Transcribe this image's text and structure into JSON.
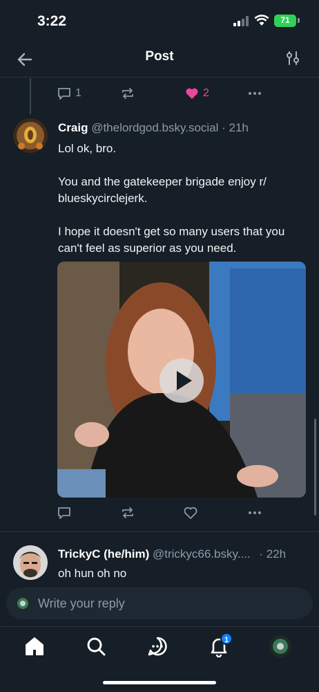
{
  "status": {
    "time": "3:22",
    "battery": "71"
  },
  "header": {
    "title": "Post"
  },
  "prev_post": {
    "reply_count": "1",
    "like_count": "2"
  },
  "post": {
    "author_name": "Craig",
    "author_handle": "@thelordgod.bsky.social",
    "time_ago": "· 21h",
    "paragraphs": [
      "Lol ok, bro.",
      "You and the gatekeeper brigade enjoy r/ blueskycirclejerk.",
      "I hope it doesn't get so many users that you can't feel as superior as you need."
    ]
  },
  "reply_post": {
    "author_name": "TrickyC (he/him)",
    "author_handle": "@trickyc66.bsky....",
    "time_ago": "· 22h",
    "text": "oh hun oh no"
  },
  "composer": {
    "placeholder": "Write your reply"
  },
  "tabs": {
    "notification_badge": "1"
  },
  "colors": {
    "background": "#161e27",
    "accent": "#1083fe",
    "like": "#ec4899",
    "muted": "#8c9aab"
  },
  "icons": [
    "back-arrow-icon",
    "sliders-icon",
    "reply-icon",
    "repost-icon",
    "heart-icon",
    "more-icon",
    "play-icon",
    "home-icon",
    "search-icon",
    "chat-icon",
    "bell-icon"
  ]
}
